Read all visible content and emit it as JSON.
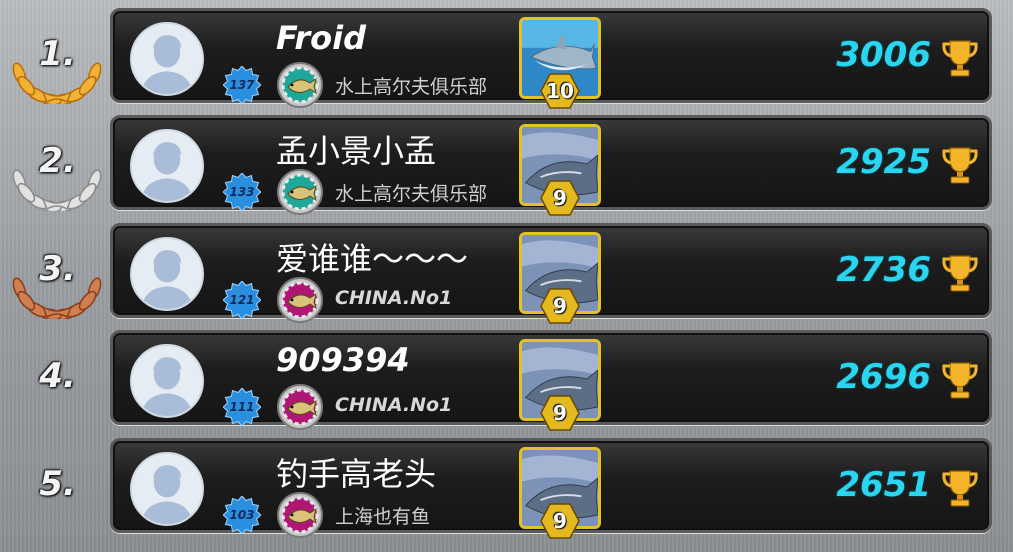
{
  "colors": {
    "score": "#2ad5f0",
    "gold": "#f2b233",
    "silver": "#d9d9d9",
    "bronze": "#c0703a",
    "level_badge": "#2b8fe0",
    "fish_frame": "#e3c12a",
    "card_bg": "#1d1d1d"
  },
  "leaderboard": [
    {
      "rank": "1.",
      "wreath": "gold-laurel-wreath",
      "name": "Froid",
      "name_style": "latin",
      "level": "137",
      "club_emblem": "teal-fish-emblem",
      "club": "水上高尔夫俱乐部",
      "club_style": "cjk",
      "fish": "shark",
      "fish_level": "10",
      "score": "3006",
      "trophy": "trophy-icon"
    },
    {
      "rank": "2.",
      "wreath": "silver-laurel-wreath",
      "name": "孟小景小孟",
      "name_style": "cjk",
      "level": "133",
      "club_emblem": "teal-fish-emblem",
      "club": "水上高尔夫俱乐部",
      "club_style": "cjk",
      "fish": "sturgeon",
      "fish_level": "9",
      "score": "2925",
      "trophy": "trophy-icon"
    },
    {
      "rank": "3.",
      "wreath": "bronze-laurel-wreath",
      "name": "爱谁谁～～～",
      "name_style": "cjk",
      "level": "121",
      "club_emblem": "magenta-fish-emblem",
      "club": "CHINA.No1",
      "club_style": "latin",
      "fish": "sturgeon",
      "fish_level": "9",
      "score": "2736",
      "trophy": "trophy-icon"
    },
    {
      "rank": "4.",
      "wreath": "",
      "name": "909394",
      "name_style": "latin",
      "level": "111",
      "club_emblem": "magenta-fish-emblem",
      "club": "CHINA.No1",
      "club_style": "latin",
      "fish": "sturgeon",
      "fish_level": "9",
      "score": "2696",
      "trophy": "trophy-icon"
    },
    {
      "rank": "5.",
      "wreath": "",
      "name": "钓手高老头",
      "name_style": "cjk",
      "level": "103",
      "club_emblem": "magenta-fish-emblem",
      "club": "上海也有鱼",
      "club_style": "cjk",
      "fish": "sturgeon",
      "fish_level": "9",
      "score": "2651",
      "trophy": "trophy-icon"
    }
  ]
}
